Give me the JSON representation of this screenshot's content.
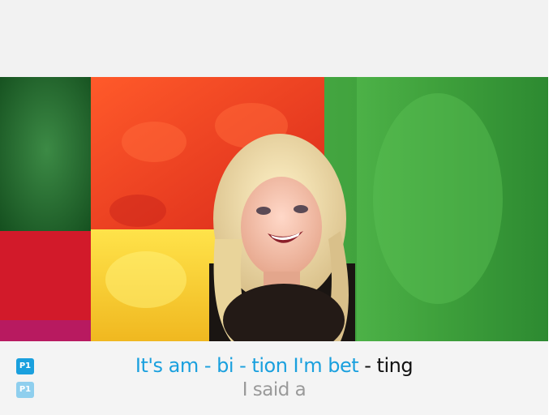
{
  "players": [
    {
      "label": "P1",
      "color": "#1aa0de"
    },
    {
      "label": "P1",
      "color": "#8fcfee"
    }
  ],
  "lyrics": {
    "current_sung": "It's am - bi - tion I'm bet",
    "current_unsung": " - ting",
    "next": "I said a"
  },
  "colors": {
    "sung": "#1aa0de",
    "unsung": "#111111",
    "next": "#9a9a9a"
  }
}
